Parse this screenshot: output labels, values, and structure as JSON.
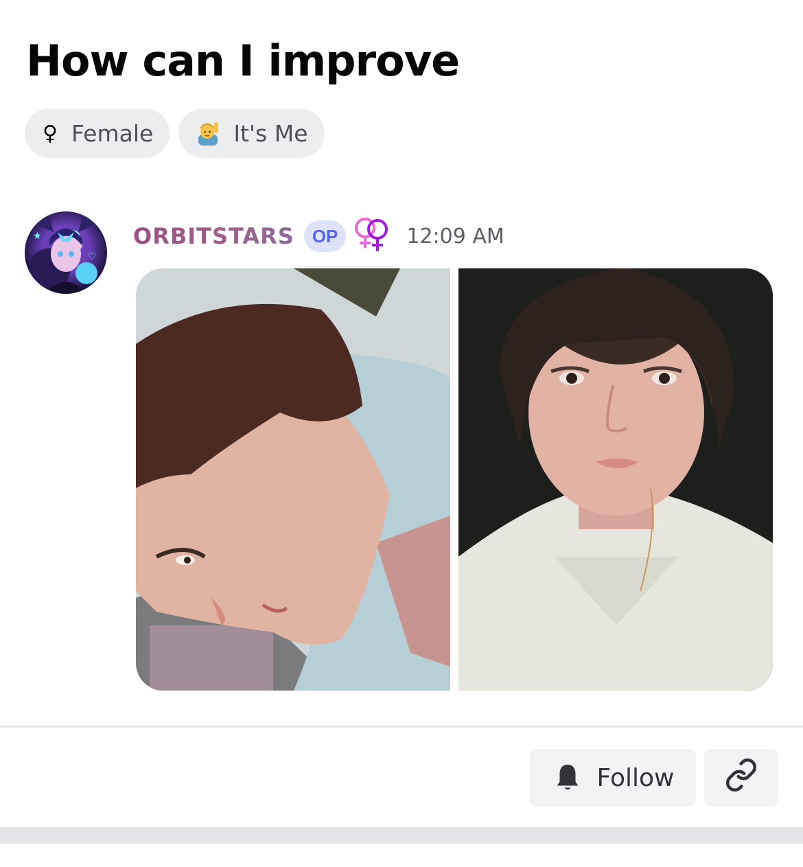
{
  "post": {
    "title": "How can I improve",
    "tags": [
      {
        "icon": "female-sign-icon",
        "label": "Female"
      },
      {
        "icon": "raising-hand-emoji-icon",
        "label": "It's Me"
      }
    ]
  },
  "message": {
    "author": "ORBITSTARS",
    "op_badge": "OP",
    "role_icon": "double-female-sign-icon",
    "timestamp": "12:09 AM",
    "attachments": [
      {
        "type": "photo"
      },
      {
        "type": "photo"
      }
    ]
  },
  "footer": {
    "follow_label": "Follow",
    "follow_icon": "bell-icon",
    "link_icon": "link-icon"
  },
  "colors": {
    "username_gradient": [
      "#9b4f86",
      "#8d6a9e"
    ],
    "op_badge_bg": "#dfe2fb",
    "op_badge_text": "#5865f2",
    "role_icon_colors": [
      "#e86ad8",
      "#a219d9"
    ],
    "tag_bg": "#ebedef",
    "button_bg": "#f2f3f5"
  }
}
